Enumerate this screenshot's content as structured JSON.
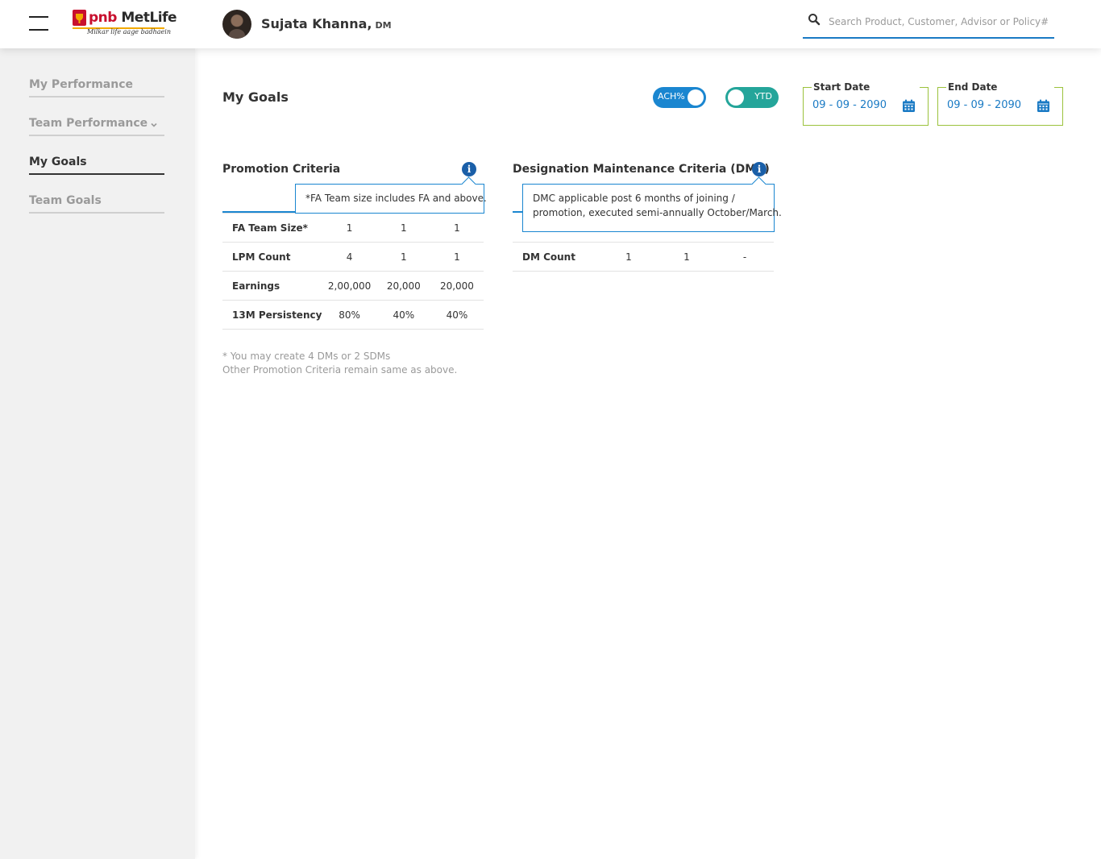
{
  "header": {
    "logo": {
      "brand_pnb": "pnb",
      "brand_metlife": "MetLife",
      "tagline": "Milkar life aage badhaein"
    },
    "user": {
      "name": "Sujata Khanna,",
      "role": "DM"
    },
    "search": {
      "placeholder": "Search Product, Customer, Advisor or Policy#"
    }
  },
  "sidebar": {
    "items": [
      {
        "label": "My Performance"
      },
      {
        "label": "Team Performance"
      },
      {
        "label": "My Goals"
      },
      {
        "label": "Team Goals"
      }
    ]
  },
  "main": {
    "title": "My Goals",
    "toggles": {
      "ach": "ACH%",
      "ytd": "YTD"
    },
    "start_date": {
      "label": "Start Date",
      "value": "09 - 09 - 2090"
    },
    "end_date": {
      "label": "End Date",
      "value": "09 - 09 - 2090"
    },
    "promotion": {
      "title": "Promotion Criteria",
      "info": "i",
      "tooltip": "*FA Team size includes FA and above.",
      "rows": [
        {
          "label": "FA Team Size*",
          "values": [
            "1",
            "1",
            "1"
          ]
        },
        {
          "label": "LPM Count",
          "values": [
            "4",
            "1",
            "1"
          ]
        },
        {
          "label": "Earnings",
          "values": [
            "2,00,000",
            "20,000",
            "20,000"
          ]
        },
        {
          "label": "13M Persistency",
          "values": [
            "80%",
            "40%",
            "40%"
          ]
        }
      ],
      "notes": [
        "* You may create 4 DMs or 2 SDMs",
        "Other Promotion Criteria remain same as above."
      ]
    },
    "dmc": {
      "title": "Designation Maintenance Criteria (DMC)",
      "info": "i",
      "tooltip_lines": [
        "DMC applicable post 6 months of joining /",
        "promotion, executed semi-annually October/March."
      ],
      "rows": [
        {
          "label": "DM Count",
          "values": [
            "1",
            "1",
            "-"
          ]
        }
      ]
    }
  },
  "colors": {
    "accent_blue": "#1a86d0",
    "teal": "#24a59a",
    "date_border": "#9bc23c",
    "brand_red": "#c8102e",
    "brand_gold": "#f2a900"
  }
}
